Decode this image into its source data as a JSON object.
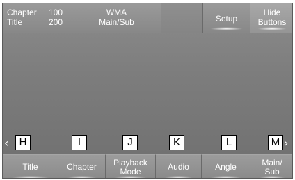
{
  "top_bar": {
    "chapter_label": "Chapter",
    "chapter_value": "100",
    "title_label": "Title",
    "title_value": "200",
    "media_format": "WMA",
    "media_mode": "Main/Sub",
    "setup_label": "Setup",
    "hide_line1": "Hide",
    "hide_line2": "Buttons"
  },
  "markers": {
    "left_arrow": "‹",
    "right_arrow": "›",
    "items": [
      "H",
      "I",
      "J",
      "K",
      "L",
      "M"
    ]
  },
  "bottom_buttons": [
    {
      "line1": "Title",
      "line2": ""
    },
    {
      "line1": "Chapter",
      "line2": ""
    },
    {
      "line1": "Playback",
      "line2": "Mode"
    },
    {
      "line1": "Audio",
      "line2": ""
    },
    {
      "line1": "Angle",
      "line2": ""
    },
    {
      "line1": "Main/",
      "line2": "Sub"
    }
  ]
}
